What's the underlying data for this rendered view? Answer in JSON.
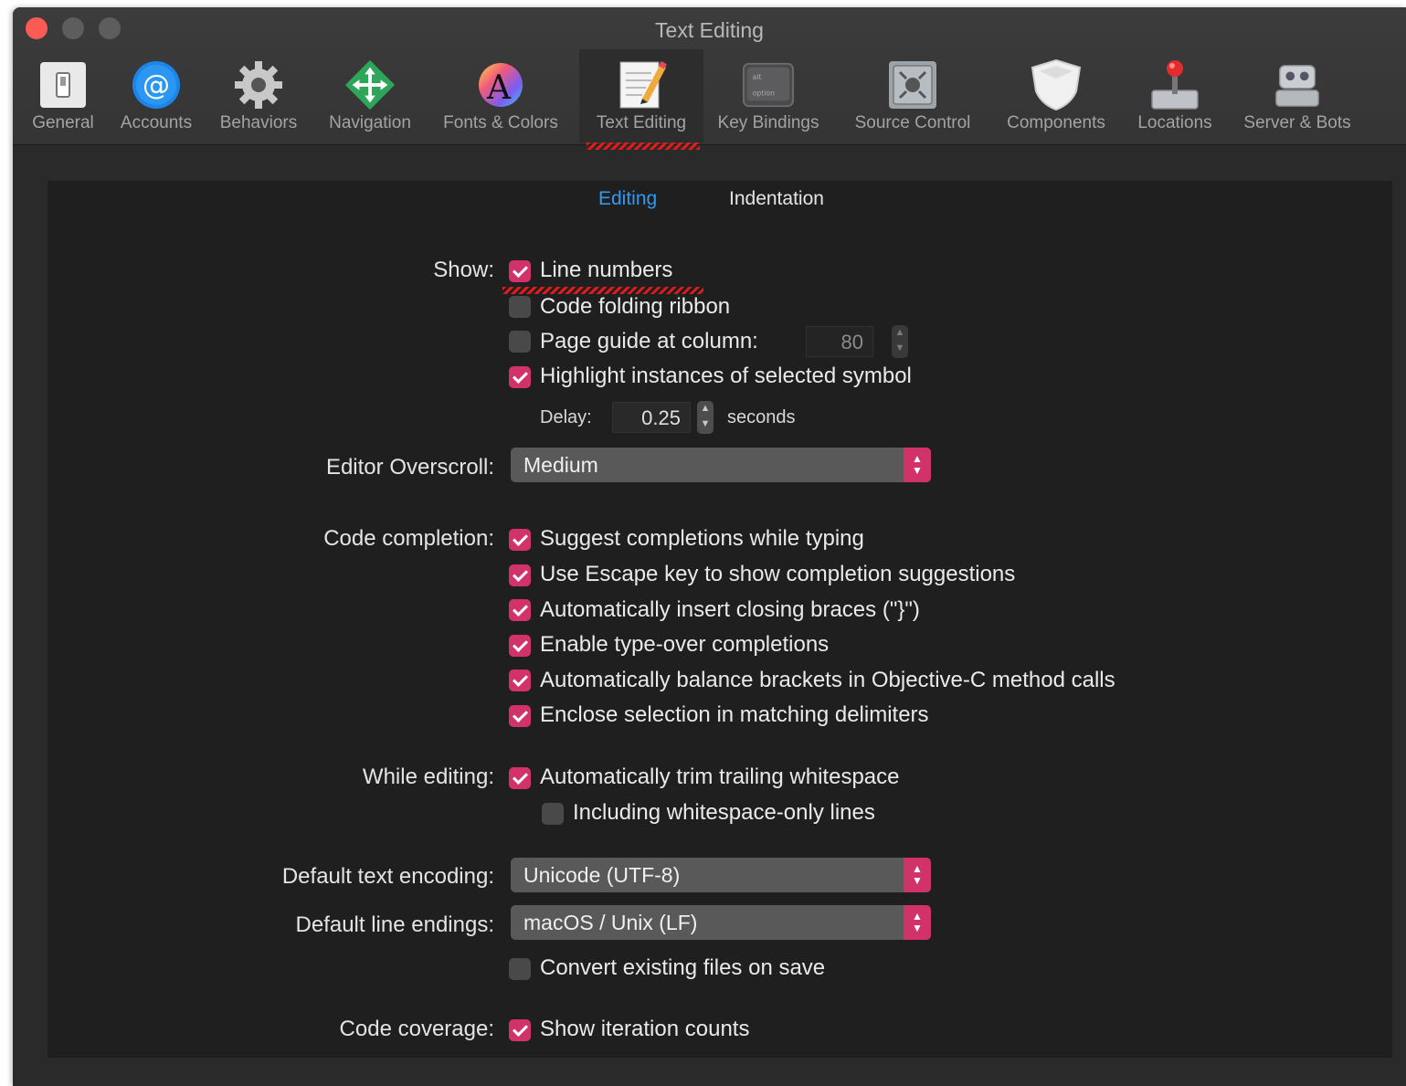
{
  "window": {
    "title": "Text Editing"
  },
  "toolbar": {
    "tabs": [
      {
        "label": "General",
        "icon": "general-switch-icon"
      },
      {
        "label": "Accounts",
        "icon": "at-sign-icon"
      },
      {
        "label": "Behaviors",
        "icon": "gear-icon"
      },
      {
        "label": "Navigation",
        "icon": "navigation-arrows-icon"
      },
      {
        "label": "Fonts & Colors",
        "icon": "font-color-icon"
      },
      {
        "label": "Text Editing",
        "icon": "pencil-paper-icon",
        "active": true
      },
      {
        "label": "Key Bindings",
        "icon": "option-key-icon"
      },
      {
        "label": "Source Control",
        "icon": "vault-icon"
      },
      {
        "label": "Components",
        "icon": "shield-icon"
      },
      {
        "label": "Locations",
        "icon": "joystick-icon"
      },
      {
        "label": "Server & Bots",
        "icon": "robot-icon"
      }
    ]
  },
  "segments": {
    "editing": "Editing",
    "indentation": "Indentation",
    "selected": "Editing"
  },
  "show": {
    "label": "Show:",
    "line_numbers": {
      "text": "Line numbers",
      "checked": true
    },
    "code_folding": {
      "text": "Code folding ribbon",
      "checked": false
    },
    "page_guide": {
      "text": "Page guide at column:",
      "checked": false,
      "value": "80"
    },
    "highlight": {
      "text": "Highlight instances of selected symbol",
      "checked": true
    },
    "delay_label": "Delay:",
    "delay_value": "0.25",
    "delay_unit": "seconds"
  },
  "overscroll": {
    "label": "Editor Overscroll:",
    "value": "Medium"
  },
  "completion": {
    "label": "Code completion:",
    "items": [
      {
        "text": "Suggest completions while typing",
        "checked": true
      },
      {
        "text": "Use Escape key to show completion suggestions",
        "checked": true
      },
      {
        "text": "Automatically insert closing braces (\"}\")",
        "checked": true
      },
      {
        "text": "Enable type-over completions",
        "checked": true
      },
      {
        "text": "Automatically balance brackets in Objective-C method calls",
        "checked": true
      },
      {
        "text": "Enclose selection in matching delimiters",
        "checked": true
      }
    ]
  },
  "while_editing": {
    "label": "While editing:",
    "trim": {
      "text": "Automatically trim trailing whitespace",
      "checked": true
    },
    "including": {
      "text": "Including whitespace-only lines",
      "checked": false
    }
  },
  "encoding": {
    "label": "Default text encoding:",
    "value": "Unicode (UTF-8)"
  },
  "line_endings": {
    "label": "Default line endings:",
    "value": "macOS / Unix (LF)",
    "convert": {
      "text": "Convert existing files on save",
      "checked": false
    }
  },
  "coverage": {
    "label": "Code coverage:",
    "iteration": {
      "text": "Show iteration counts",
      "checked": true
    }
  },
  "colors": {
    "accent": "#d2326a",
    "selected_segment": "#2e9bf0",
    "annotation": "#e01b1b"
  }
}
